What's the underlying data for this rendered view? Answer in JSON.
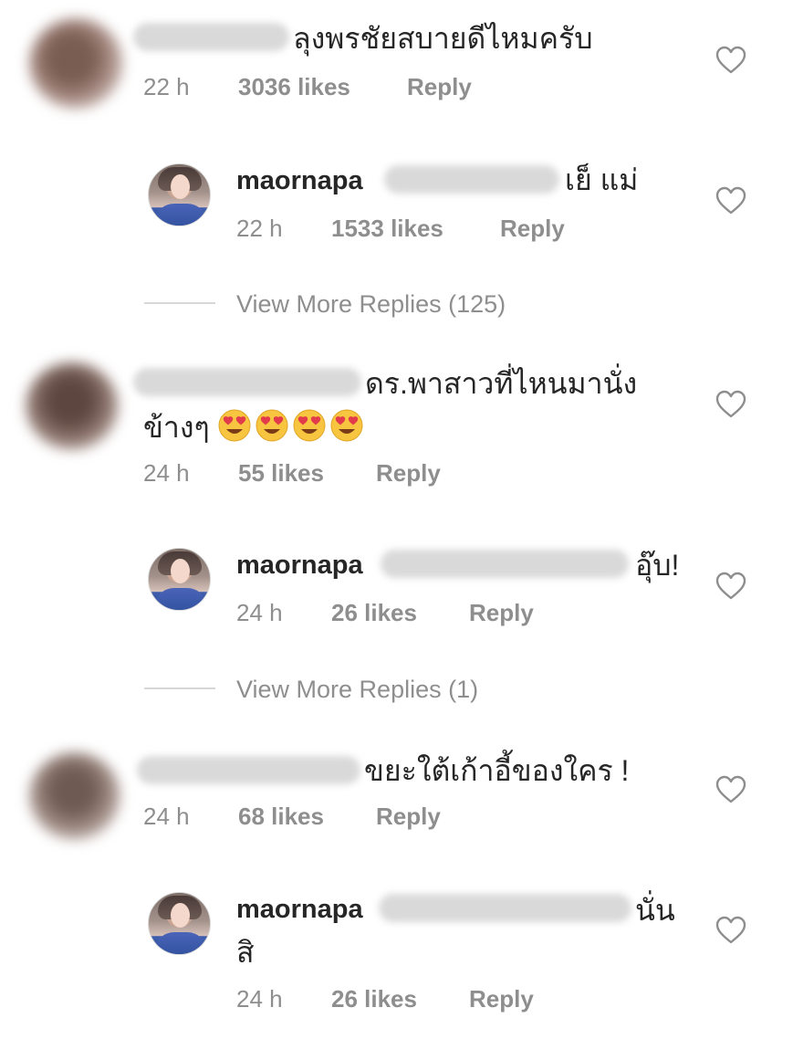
{
  "threads": [
    {
      "comment": {
        "text": "ลุงพรชัยสบายดีไหมครับ",
        "time": "22 h",
        "likes": "3036 likes",
        "reply_label": "Reply"
      },
      "reply": {
        "username": "maornapa",
        "text": "เย็ แม่",
        "time": "22 h",
        "likes": "1533 likes",
        "reply_label": "Reply"
      },
      "view_more": "View More Replies (125)"
    },
    {
      "comment": {
        "text_line1": "ดร.พาสาวที่ไหนมานั่ง",
        "text_line2": "ข้างๆ",
        "emoji": "smiling-face-with-heart-eyes",
        "emoji_count": 4,
        "time": "24 h",
        "likes": "55 likes",
        "reply_label": "Reply"
      },
      "reply": {
        "username": "maornapa",
        "text": "อุ๊บ!",
        "time": "24 h",
        "likes": "26 likes",
        "reply_label": "Reply"
      },
      "view_more": "View More Replies (1)"
    },
    {
      "comment": {
        "text": "ขยะใต้เก้าอี้ของใคร !",
        "time": "24 h",
        "likes": "68 likes",
        "reply_label": "Reply"
      },
      "reply": {
        "username": "maornapa",
        "text_line1": "นั่น",
        "text_line2": "สิ",
        "time": "24 h",
        "likes": "26 likes",
        "reply_label": "Reply"
      }
    }
  ],
  "icons": {
    "like": "heart-outline-icon"
  },
  "colors": {
    "text_primary": "#262626",
    "text_secondary": "#8e8e8e",
    "divider": "#d7d7d7",
    "heart_stroke": "#8e8e8e",
    "emoji_face": "#f7c53f",
    "emoji_heart": "#e23b4c"
  }
}
